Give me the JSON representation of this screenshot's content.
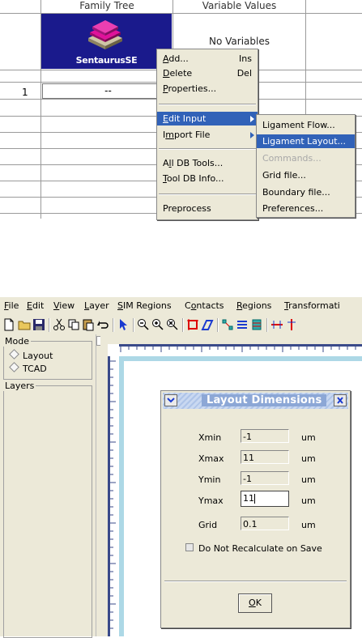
{
  "workbench": {
    "headers": {
      "family_tree": "Family Tree",
      "variable_values": "Variable Values"
    },
    "tool_label": "SentaurusSE",
    "no_variables": "No Variables",
    "row1": {
      "number": "1",
      "value": "--"
    },
    "context_menu": [
      {
        "label": "Add...",
        "accel": "A",
        "shortcut": "Ins"
      },
      {
        "label": "Delete",
        "accel": "D",
        "shortcut": "Del"
      },
      {
        "label": "Properties...",
        "accel": "P",
        "shortcut": ""
      },
      {
        "label": "Edit Input",
        "accel": "E",
        "shortcut": "",
        "selected": true,
        "submenu": true
      },
      {
        "label": "Import File",
        "accel": "m",
        "shortcut": "",
        "submenu": true
      },
      {
        "label": "All DB Tools...",
        "accel": "l",
        "shortcut": ""
      },
      {
        "label": "Tool DB Info...",
        "accel": "T",
        "shortcut": ""
      },
      {
        "label": "Preprocess",
        "accel": "",
        "shortcut": ""
      }
    ],
    "submenu": [
      {
        "label": "Ligament Flow...",
        "state": "normal"
      },
      {
        "label": "Ligament Layout...",
        "state": "selected"
      },
      {
        "label": "Commands...",
        "state": "disabled"
      },
      {
        "label": "Grid file...",
        "state": "normal"
      },
      {
        "label": "Boundary file...",
        "state": "normal"
      },
      {
        "label": "Preferences...",
        "state": "normal"
      }
    ]
  },
  "editor": {
    "menubar": [
      "File",
      "Edit",
      "View",
      "Layer",
      "SIM Regions",
      "Contacts",
      "Regions",
      "Transformati"
    ],
    "mode_group": {
      "title": "Mode",
      "options": [
        "Layout",
        "TCAD"
      ]
    },
    "layers_group": {
      "title": "Layers"
    },
    "dialog": {
      "title": "Layout Dimensions",
      "fields": [
        {
          "label": "Xmin",
          "value": "-1",
          "unit": "um"
        },
        {
          "label": "Xmax",
          "value": "11",
          "unit": "um"
        },
        {
          "label": "Ymin",
          "value": "-1",
          "unit": "um"
        },
        {
          "label": "Ymax",
          "value": "11",
          "unit": "um",
          "active": true
        },
        {
          "label": "Grid",
          "value": "0.1",
          "unit": "um"
        }
      ],
      "checkbox_label": "Do Not Recalculate on Save",
      "ok_label": "OK"
    }
  },
  "colors": {
    "tool_bg": "#1a1a8c",
    "menu_highlight": "#3162b8",
    "canvas_border": "#add8e6"
  }
}
